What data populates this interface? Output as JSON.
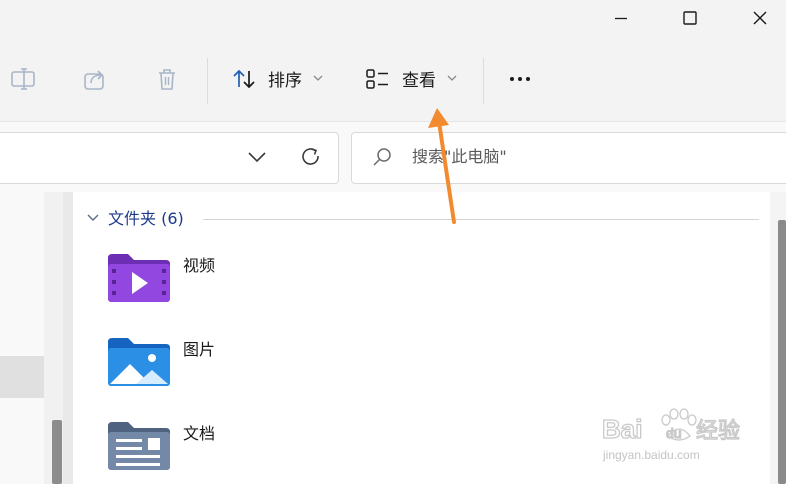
{
  "window": {
    "minimize_icon": "minimize-icon",
    "maximize_icon": "maximize-icon",
    "close_icon": "close-icon"
  },
  "toolbar": {
    "sort_label": "排序",
    "view_label": "查看",
    "more_icon": "more-icon"
  },
  "search": {
    "placeholder": "搜索\"此电脑\""
  },
  "content": {
    "group_header": "文件夹 (6)",
    "folders": [
      {
        "label": "视频",
        "icon": "video-folder-icon"
      },
      {
        "label": "图片",
        "icon": "pictures-folder-icon"
      },
      {
        "label": "文档",
        "icon": "documents-folder-icon"
      }
    ]
  },
  "watermark": {
    "brand": "Baidu经验",
    "url": "jingyan.baidu.com"
  },
  "colors": {
    "accent_arrow": "#f28b30",
    "group_header": "#1d3a8a",
    "video_folder": "#8b3fd1",
    "pictures_folder": "#1e8de0",
    "documents_folder": "#6b7f9a"
  }
}
